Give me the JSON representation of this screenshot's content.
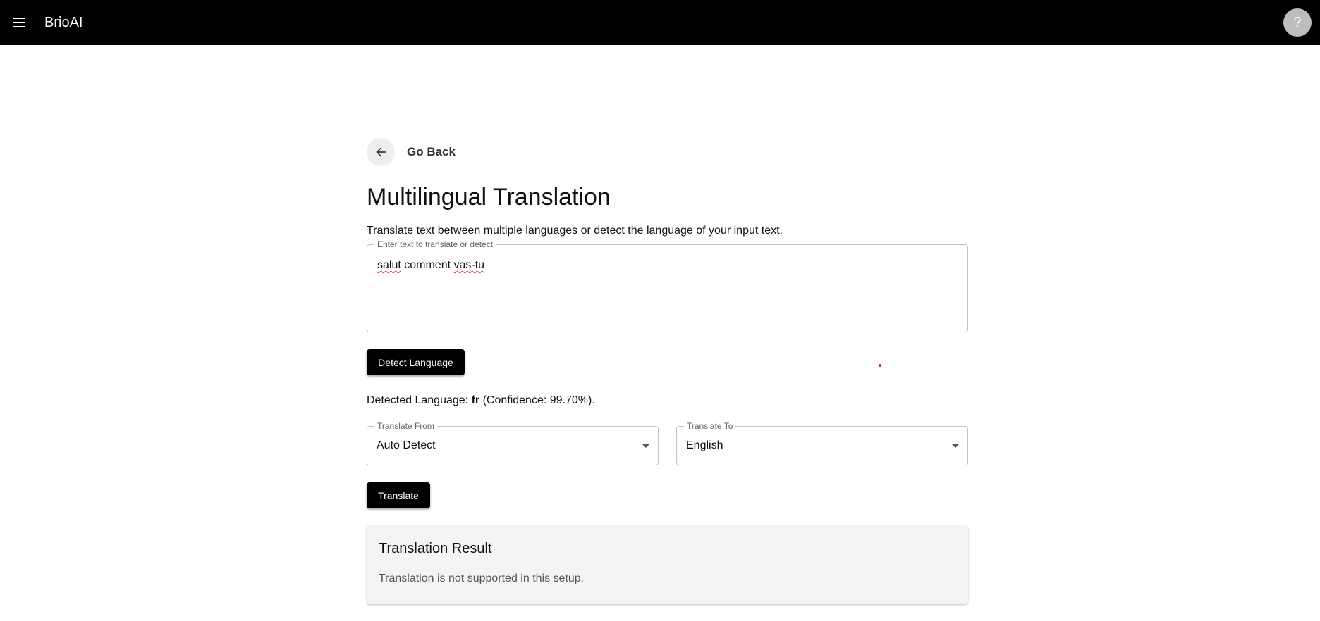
{
  "appbar": {
    "brand": "BrioAI",
    "menu_icon": "menu-icon",
    "help_label": "?"
  },
  "navigation": {
    "back_label": "Go Back",
    "back_icon": "arrow-left-icon"
  },
  "page": {
    "title": "Multilingual Translation",
    "description": "Translate text between multiple languages or detect the language of your input text."
  },
  "input": {
    "label": "Enter text to translate or detect",
    "value_parts": [
      "salut",
      " comment ",
      "vas-tu"
    ]
  },
  "detect": {
    "button_label": "Detect Language",
    "result_prefix": "Detected Language: ",
    "language_code": "fr",
    "result_suffix": " (Confidence: 99.70%)."
  },
  "translate_from": {
    "label": "Translate From",
    "value": "Auto Detect"
  },
  "translate_to": {
    "label": "Translate To",
    "value": "English"
  },
  "translate": {
    "button_label": "Translate"
  },
  "result": {
    "title": "Translation Result",
    "text": "Translation is not supported in this setup."
  },
  "colors": {
    "appbar_bg": "#000000",
    "primary_button": "#000000",
    "result_card_bg": "#f4f4f4",
    "cursor_dot": "#d32f2f"
  }
}
